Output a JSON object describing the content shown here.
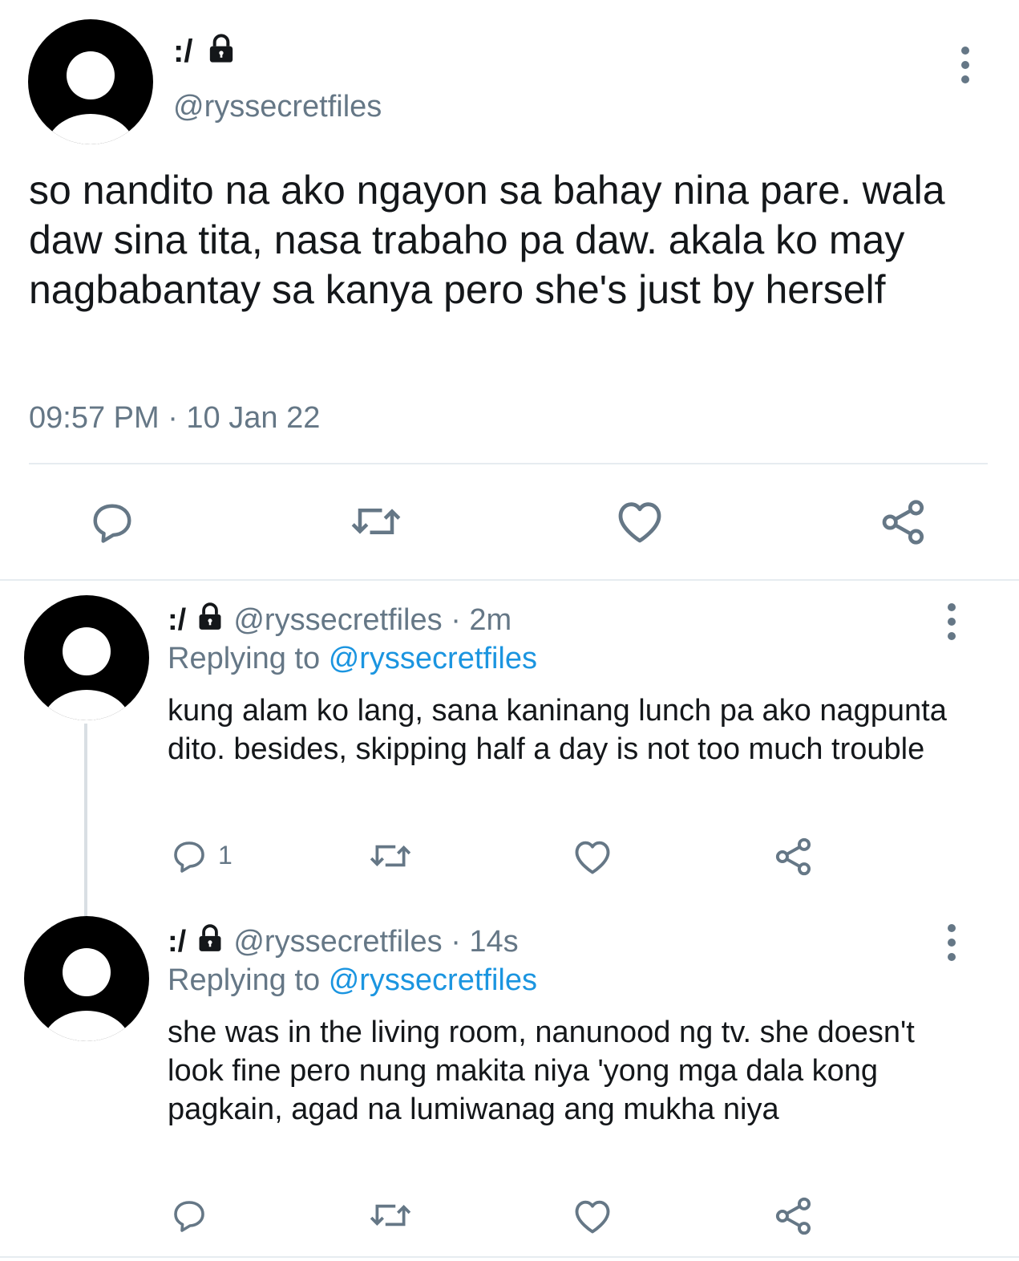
{
  "main_tweet": {
    "display_name": ":/",
    "handle": "@ryssecretfiles",
    "text": "so nandito na ako ngayon sa bahay nina pare. wala daw sina tita, nasa trabaho pa daw. akala ko may nagbabantay sa kanya pero she's just by herself",
    "timestamp": "09:57 PM · 10 Jan 22"
  },
  "replies": [
    {
      "display_name": ":/",
      "handle": "@ryssecretfiles",
      "age": "· 2m",
      "replying_label": "Replying to",
      "replying_to": "@ryssecretfiles",
      "text": "kung alam ko lang, sana kaninang lunch pa ako nagpunta dito. besides, skipping half a day is not too much trouble",
      "reply_count": "1"
    },
    {
      "display_name": ":/",
      "handle": "@ryssecretfiles",
      "age": "· 14s",
      "replying_label": "Replying to",
      "replying_to": "@ryssecretfiles",
      "text": "she was in the living room, nanunood ng tv. she doesn't look fine pero nung makita niya 'yong mga dala kong pagkain, agad na lumiwanag ang mukha niya",
      "reply_count": ""
    }
  ],
  "icons": [
    "lock-icon",
    "more-icon",
    "reply-icon",
    "retweet-icon",
    "like-icon",
    "share-icon"
  ],
  "colors": {
    "text": "#14171a",
    "muted": "#657786",
    "link": "#1b95e0",
    "divider": "#e6ecf0"
  }
}
